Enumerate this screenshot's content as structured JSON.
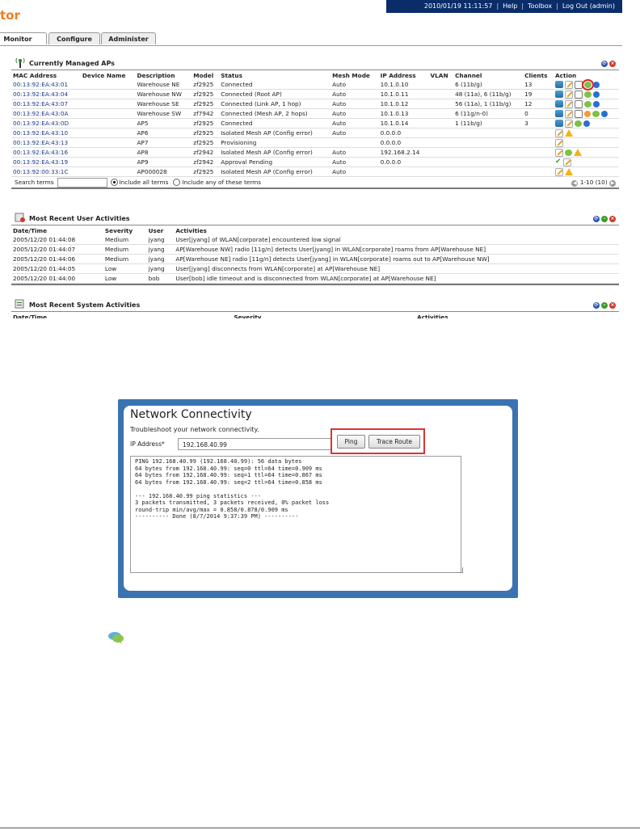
{
  "app": {
    "title_fragment": "tor"
  },
  "topbar": {
    "datetime": "2010/01/19  11:11:57",
    "links": [
      "Help",
      "Toolbox",
      "Log Out (admin)"
    ]
  },
  "tabs": [
    "Monitor",
    "Configure",
    "Administer"
  ],
  "aps": {
    "title": "Currently Managed APs",
    "columns": [
      "MAC Address",
      "Device Name",
      "Description",
      "Model",
      "Status",
      "Mesh Mode",
      "IP Address",
      "VLAN",
      "Channel",
      "Clients",
      "Action"
    ],
    "rows": [
      [
        "00:13:92:EA:43:01",
        "",
        "Warehouse NE",
        "zf2925",
        "Connected",
        "Auto",
        "10.1.0.10",
        "",
        "6 (11b/g)",
        "13"
      ],
      [
        "00:13:92:EA:43:04",
        "",
        "Warehouse NW",
        "zf2925",
        "Connected (Root AP)",
        "Auto",
        "10.1.0.11",
        "",
        "48 (11a), 6 (11b/g)",
        "19"
      ],
      [
        "00:13:92:EA:43:07",
        "",
        "Warehouse SE",
        "zf2925",
        "Connected (Link AP, 1 hop)",
        "Auto",
        "10.1.0.12",
        "",
        "56 (11a), 1 (11b/g)",
        "12"
      ],
      [
        "00:13:92:EA:43:0A",
        "",
        "Warehouse SW",
        "zf7942",
        "Connected (Mesh AP, 2 hops)",
        "Auto",
        "10.1.0.13",
        "",
        "6 (11g/n-0)",
        "0"
      ],
      [
        "00:13:92:EA:43:0D",
        "",
        "AP5",
        "zf2925",
        "Connected",
        "Auto",
        "10.1.0.14",
        "",
        "1 (11b/g)",
        "3"
      ],
      [
        "00:13:92:EA:43:10",
        "",
        "AP6",
        "zf2925",
        "Isolated Mesh AP (Config error)",
        "Auto",
        "0.0.0.0",
        "",
        "",
        ""
      ],
      [
        "00:13:92:EA:43:13",
        "",
        "AP7",
        "zf2925",
        "Provisioning",
        "",
        "0.0.0.0",
        "",
        "",
        ""
      ],
      [
        "00:13:92:EA:43:16",
        "",
        "AP8",
        "zf2942",
        "Isolated Mesh AP (Config error)",
        "Auto",
        "192.168.2.14",
        "",
        "",
        ""
      ],
      [
        "00:13:92:EA:43:19",
        "",
        "AP9",
        "zf2942",
        "Approval Pending",
        "Auto",
        "0.0.0.0",
        "",
        "",
        ""
      ],
      [
        "00:13:92:00:33:1C",
        "",
        "AP000028",
        "zf2925",
        "Isolated Mesh AP (Config error)",
        "Auto",
        "",
        "",
        "",
        ""
      ]
    ],
    "search_label": "Search terms",
    "opt_all": "Include all terms",
    "opt_any": "Include any of these terms",
    "pager": "1-10 (10)"
  },
  "user_act": {
    "title": "Most Recent User Activities",
    "columns": [
      "Date/Time",
      "Severity",
      "User",
      "Activities"
    ],
    "rows": [
      [
        "2005/12/20  01:44:08",
        "Medium",
        "jyang",
        "User[jyang] of WLAN[corporate] encountered low signal"
      ],
      [
        "2005/12/20  01:44:07",
        "Medium",
        "jyang",
        "AP[Warehouse NW] radio [11g/n] detects User[jyang] in WLAN[corporate] roams from AP[Warehouse NE]"
      ],
      [
        "2005/12/20  01:44:06",
        "Medium",
        "jyang",
        "AP[Warehouse NE] radio [11g/n] detects User[jyang] in WLAN[corporate] roams out to AP[Warehouse NW]"
      ],
      [
        "2005/12/20  01:44:05",
        "Low",
        "jyang",
        "User[jyang] disconnects from WLAN[corporate] at AP[Warehouse NE]"
      ],
      [
        "2005/12/20  01:44:00",
        "Low",
        "bob",
        "User[bob] idle timeout and is disconnected from WLAN[corporate] at AP[Warehouse NE]"
      ]
    ]
  },
  "sys_act": {
    "title": "Most Recent System Activities",
    "columns": [
      "Date/Time",
      "Severity",
      "Activities"
    ]
  },
  "netcon": {
    "title": "Network Connectivity",
    "subtitle": "Troubleshoot your network connectivity.",
    "ip_label": "IP Address*",
    "ip_value": "192.168.40.99",
    "ping": "Ping",
    "trace": "Trace Route",
    "output": "PING 192.168.40.99 (192.168.40.99): 56 data bytes\n64 bytes from 192.168.40.99: seq=0 ttl=64 time=0.909 ms\n64 bytes from 192.168.40.99: seq=1 ttl=64 time=0.867 ms\n64 bytes from 192.168.40.99: seq=2 ttl=64 time=0.858 ms\n\n--- 192.168.40.99 ping statistics ---\n3 packets transmitted, 3 packets received, 0% packet loss\nround-trip min/avg/max = 0.858/0.878/0.909 ms\n---------- Done (8/7/2014 9:37:39 PM) ----------"
  },
  "colors": {
    "accent": "#f07c1e",
    "topbar": "#0a2d6a",
    "link": "#1f3a8a",
    "frame": "#3b73b1",
    "highlight": "#e02020"
  }
}
